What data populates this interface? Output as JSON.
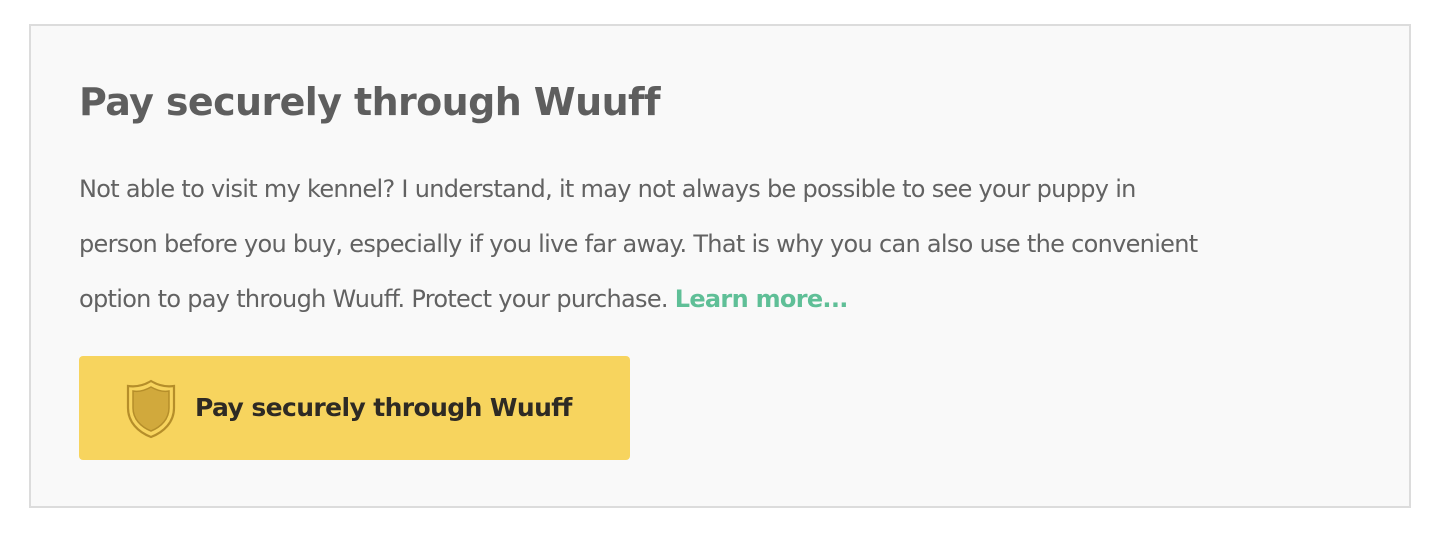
{
  "card": {
    "title": "Pay securely through Wuuff",
    "description_lines": [
      "Not able to visit my kennel? I understand, it may not always be possible to see your puppy in",
      "person before you buy, especially if you live far away. That is why you can also use the convenient",
      "option to pay through Wuuff. Protect your purchase. "
    ],
    "learn_more_label": "Learn more...",
    "pay_button_label": "Pay securely through Wuuff",
    "pay_button_icon": "shield-icon"
  },
  "colors": {
    "card_background": "#f9f9f9",
    "card_border": "#dcdcdc",
    "title_text": "#5e5e5e",
    "body_text": "#626262",
    "link": "#5fbf97",
    "button_background": "#f7d45e",
    "button_text": "#2e2a24",
    "shield_fill": "#d1a93c",
    "shield_stroke": "#b58e2a"
  }
}
